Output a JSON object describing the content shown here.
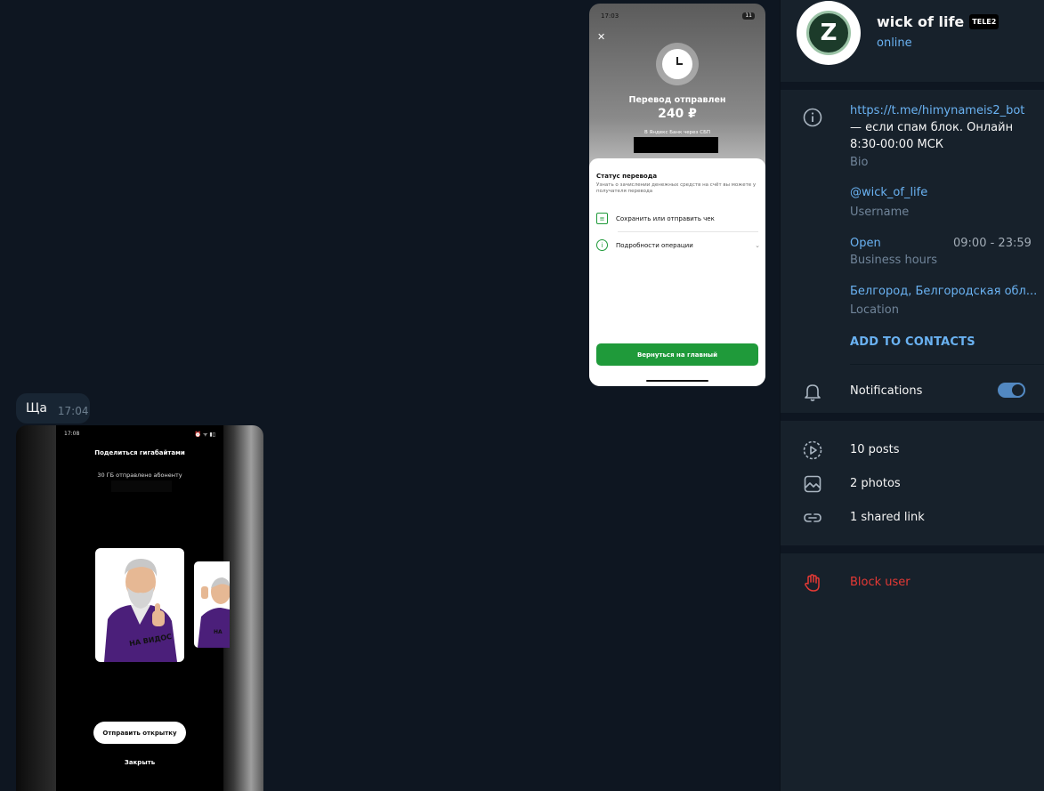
{
  "chat": {
    "photo1": {
      "status_time": "17:03",
      "status_battery": "11",
      "title": "Перевод отправлен",
      "amount": "240 ₽",
      "via": "В Яндекс Банк через СБП",
      "sheet_title": "Статус перевода",
      "sheet_subtitle": "Узнать о зачислении денежных средств на счёт вы можете у получателя перевода",
      "row_receipt": "Сохранить или отправить чек",
      "row_details": "Подробности операции",
      "home_button": "Вернуться на главный",
      "accent_color": "#1f9a3a"
    },
    "message": {
      "text": "Ща",
      "time": "17:04"
    },
    "photo2": {
      "status_time": "17:08",
      "title": "Поделиться гигабайтами",
      "subtitle": "30 ГБ отправлено абоненту",
      "card_caption": "НА ВИДОС",
      "card2_caption": "НА",
      "send_button": "Отправить открытку",
      "close_button": "Закрыть"
    }
  },
  "profile": {
    "name": "wick of life",
    "badge": "TELE2",
    "status": "online",
    "avatar_letter": "Z",
    "bio_link": "https://t.me/himynameis2_bot",
    "bio_text": "— если спам блок. Онлайн 8:30-00:00 МСК",
    "bio_label": "Bio",
    "username": "@wick_of_life",
    "username_label": "Username",
    "hours_status": "Open",
    "hours_range": "09:00 - 23:59",
    "hours_label": "Business hours",
    "location": "Белгород, Белгородская обл...",
    "location_label": "Location",
    "add_contacts": "ADD TO CONTACTS",
    "notifications_label": "Notifications",
    "notifications_on": true,
    "posts": "10 posts",
    "photos": "2 photos",
    "links": "1 shared link",
    "block": "Block user",
    "accent_color": "#6ab2f2",
    "danger_color": "#e53935",
    "icons": [
      "info-icon",
      "bell-icon",
      "posts-icon",
      "photo-icon",
      "link-icon",
      "hand-icon"
    ]
  }
}
